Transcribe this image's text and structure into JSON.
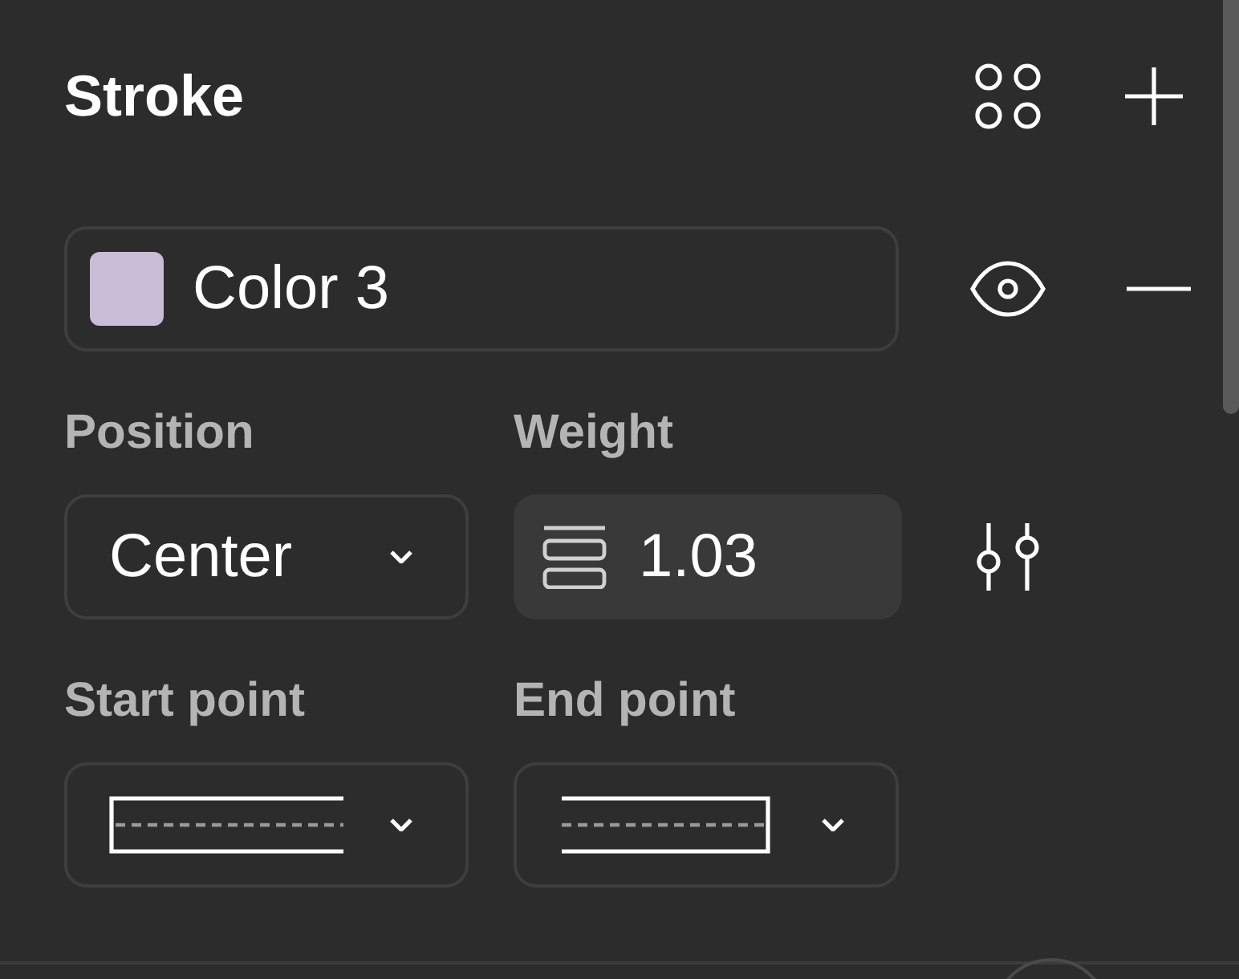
{
  "panel": {
    "title": "Stroke"
  },
  "fill": {
    "name": "Color 3",
    "color": "#c8bcd6",
    "visible": true
  },
  "position": {
    "label": "Position",
    "value": "Center"
  },
  "weight": {
    "label": "Weight",
    "value": "1.03"
  },
  "endpoints": [
    {
      "label": "Start point",
      "kind": "start"
    },
    {
      "label": "End point",
      "kind": "end"
    }
  ]
}
